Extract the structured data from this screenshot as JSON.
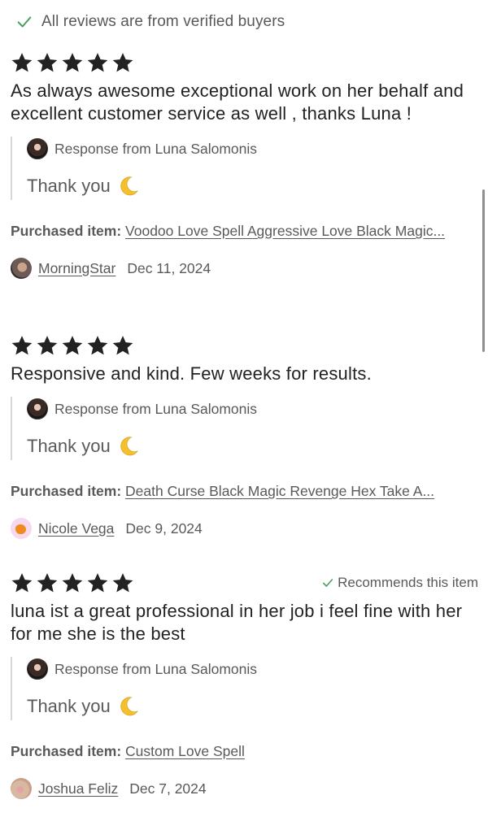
{
  "header": {
    "verified_text": "All reviews are from verified buyers"
  },
  "colors": {
    "check_green": "#4a9e5c",
    "star_color": "#222222",
    "muted_text": "#595959"
  },
  "reviews": [
    {
      "rating": 5,
      "recommends": "",
      "text": "As always awesome exceptional work on her behalf and excellent customer service as well , thanks Luna !",
      "response_label": "Response from Luna Salomonis",
      "response_text": "Thank you",
      "purchased_label": "Purchased item:",
      "purchased_item": "Voodoo Love Spell Aggressive Love Black Magic...",
      "reviewer": "MorningStar",
      "date": "Dec 11, 2024"
    },
    {
      "rating": 5,
      "recommends": "",
      "text": "Responsive and kind. Few weeks for results.",
      "response_label": "Response from Luna Salomonis",
      "response_text": "Thank you",
      "purchased_label": "Purchased item:",
      "purchased_item": "Death Curse Black Magic Revenge Hex Take A...",
      "reviewer": "Nicole Vega",
      "date": "Dec 9, 2024"
    },
    {
      "rating": 5,
      "recommends": "Recommends this item",
      "text": "luna ist a great professional in her job i feel fine with her for me she is the best",
      "response_label": "Response from Luna Salomonis",
      "response_text": "Thank you",
      "purchased_label": "Purchased item:",
      "purchased_item": "Custom Love Spell",
      "reviewer": "Joshua Feliz",
      "date": "Dec 7, 2024"
    }
  ]
}
